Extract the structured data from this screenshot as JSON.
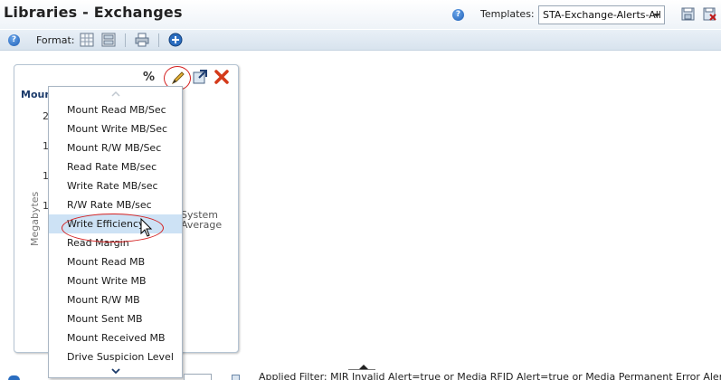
{
  "header": {
    "title": "Libraries - Exchanges",
    "templates_label": "Templates:",
    "templates_value": "STA-Exchange-Alerts-All"
  },
  "toolbar": {
    "format_label": "Format:"
  },
  "portlet": {
    "title": "Mount",
    "y_ticks": [
      "2",
      "1",
      "1",
      "1"
    ],
    "y_axis_label": "Megabytes",
    "legend": "System Average"
  },
  "dropdown": {
    "items": [
      "Mount Read MB/Sec",
      "Mount Write MB/Sec",
      "Mount R/W MB/Sec",
      "Read Rate MB/sec",
      "Write Rate MB/sec",
      "R/W Rate MB/sec",
      "Write Efficiency",
      "Read Margin",
      "Mount Read MB",
      "Mount Write MB",
      "Mount R/W MB",
      "Mount Sent MB",
      "Mount Received MB",
      "Drive Suspicion Level"
    ],
    "selected": "Write Efficiency"
  },
  "footer": {
    "applied_filter": "Applied Filter: MIR Invalid Alert=true or Media RFID Alert=true or Media Permanent Error Alert=true or"
  },
  "colors": {
    "accent": "#1f5fb6",
    "highlight": "#cde2f5",
    "annotation_red": "#d42020",
    "title_blue": "#1c3b6b"
  }
}
